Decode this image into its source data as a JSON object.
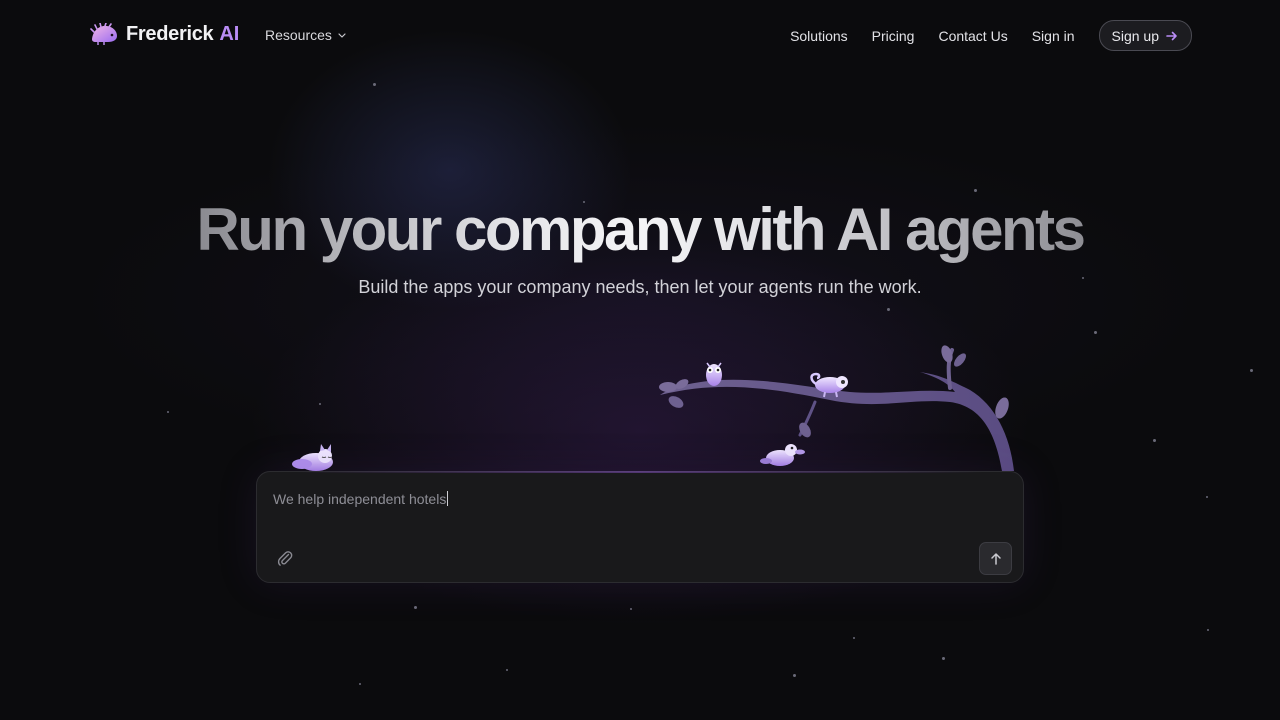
{
  "nav": {
    "brand": "Frederick",
    "brand_suffix": "AI",
    "resources_label": "Resources",
    "links": [
      "Solutions",
      "Pricing",
      "Contact Us",
      "Sign in"
    ],
    "signup_label": "Sign up"
  },
  "hero": {
    "headline": "Run your company with AI agents",
    "subheadline": "Build the apps your company needs, then let your agents run the work."
  },
  "prompt": {
    "value": "We help independent hotels"
  },
  "icons": {
    "logo": "hedgehog-logo-icon",
    "resources_chevron": "chevron-down-icon",
    "signup_arrow": "arrow-right-icon",
    "attach": "paperclip-icon",
    "send": "arrow-up-icon"
  },
  "colors": {
    "background": "#0b0b0d",
    "accent": "#b98cf5",
    "prompt_bg": "#19191b"
  }
}
